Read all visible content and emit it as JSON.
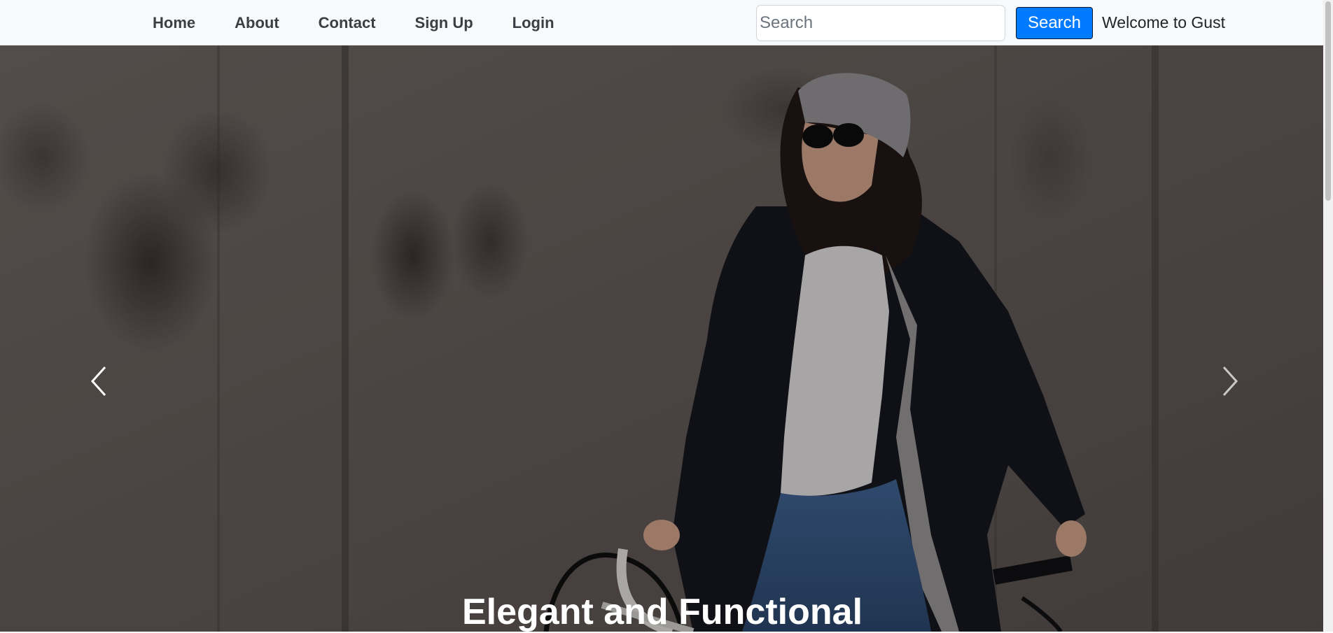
{
  "nav": {
    "links": [
      {
        "label": "Home"
      },
      {
        "label": "About"
      },
      {
        "label": "Contact"
      },
      {
        "label": "Sign Up"
      },
      {
        "label": "Login"
      }
    ],
    "search": {
      "placeholder": "Search",
      "value": "",
      "button_label": "Search"
    },
    "welcome_text": "Welcome to Gust"
  },
  "carousel": {
    "caption": "Elegant and Functional",
    "prev_icon": "chevron-left-icon",
    "next_icon": "chevron-right-icon",
    "image_description": "hero-photo"
  },
  "colors": {
    "navbar_bg": "#f8f9fa",
    "nav_link": "#3a3f44",
    "search_button": "#007bff",
    "caption_text": "#ffffff"
  }
}
